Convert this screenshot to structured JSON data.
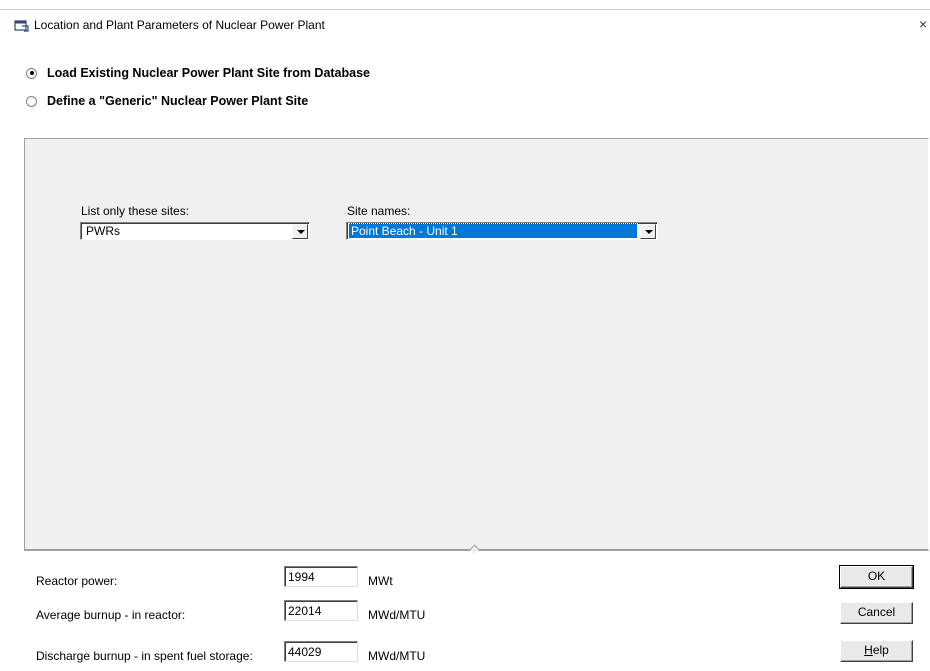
{
  "window": {
    "title": "Location and Plant Parameters of Nuclear Power Plant",
    "close_glyph": "×"
  },
  "site_source": {
    "options": [
      {
        "label": "Load Existing Nuclear Power Plant Site from Database",
        "checked": true
      },
      {
        "label": "Define a \"Generic\" Nuclear Power Plant Site",
        "checked": false
      }
    ]
  },
  "filters": {
    "list_only_label": "List only these sites:",
    "list_only_value": "PWRs",
    "site_names_label": "Site names:",
    "site_names_value": "Point Beach - Unit 1"
  },
  "parameters": [
    {
      "label": "Reactor power:",
      "value": "1994",
      "unit": "MWt"
    },
    {
      "label": "Average burnup - in reactor:",
      "value": "22014",
      "unit": "MWd/MTU"
    },
    {
      "label": "Discharge burnup - in spent fuel storage:",
      "value": "44029",
      "unit": "MWd/MTU"
    }
  ],
  "buttons": {
    "ok": "OK",
    "cancel": "Cancel",
    "help_prefix": "H",
    "help_rest": "elp"
  },
  "colors": {
    "selection": "#0078d7",
    "panel_bg": "#f0f0f0"
  }
}
